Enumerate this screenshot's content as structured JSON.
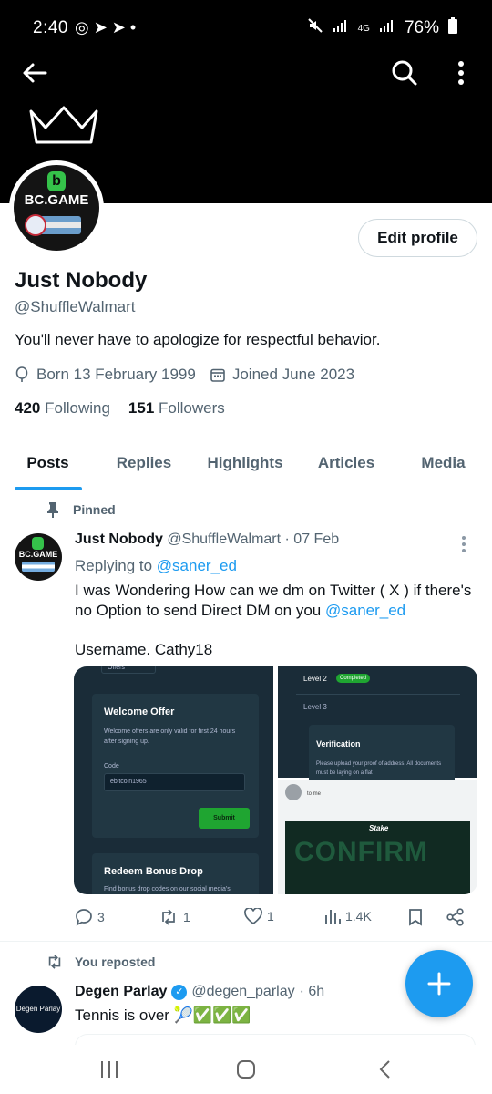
{
  "status_bar": {
    "time": "2:40",
    "left_icons": "◎ ➤ ➤ •",
    "network": "4G",
    "battery": "76%"
  },
  "profile": {
    "avatar_text": "BC.GAME",
    "avatar_logo": "b",
    "edit_button": "Edit profile",
    "name": "Just Nobody",
    "handle": "@ShuffleWalmart",
    "bio": "You'll never have to apologize for respectful behavior.",
    "birth": "Born 13 February 1999",
    "joined": "Joined June 2023",
    "following_count": "420",
    "following_label": "Following",
    "followers_count": "151",
    "followers_label": "Followers"
  },
  "tabs": [
    {
      "label": "Posts",
      "active": true
    },
    {
      "label": "Replies",
      "active": false
    },
    {
      "label": "Highlights",
      "active": false
    },
    {
      "label": "Articles",
      "active": false
    },
    {
      "label": "Media",
      "active": false
    }
  ],
  "pinned_post": {
    "pinned_label": "Pinned",
    "author_name": "Just Nobody",
    "author_handle": "@ShuffleWalmart",
    "date": "· 07 Feb",
    "replying_prefix": "Replying to",
    "replying_to": "@saner_ed",
    "text": "I was Wondering How can we dm on Twitter ( X ) if there's no Option to send Direct DM on you",
    "text_mention": "@saner_ed",
    "text_line2": "Username. Cathy18",
    "media": {
      "img1": {
        "top_label": "Offers",
        "title": "Welcome Offer",
        "desc": "Welcome offers are only valid for first 24 hours after signing up.",
        "code_label": "Code",
        "code_value": "ebitcoin1965",
        "submit": "Submit",
        "title2": "Redeem Bonus Drop",
        "desc2": "Find bonus drop codes on our social media's"
      },
      "img2": {
        "level2": "Level 2",
        "completed": "Completed",
        "level3": "Level 3",
        "verification": "Verification",
        "desc": "Please upload your proof of address. All documents must be laying on a flat"
      },
      "img3": {
        "to_me": "to me",
        "brand": "Stake",
        "confirm": "CONFIRM"
      }
    },
    "replies": "3",
    "reposts": "1",
    "likes": "1",
    "views": "1.4K"
  },
  "repost": {
    "label": "You reposted",
    "author_name": "Degen Parlay",
    "author_handle": "@degen_parlay",
    "time": "· 6h",
    "text": "Tennis is over 🎾✅✅✅",
    "avatar_text": "Degen Parlay"
  },
  "colors": {
    "accent": "#1d9bf0",
    "secondary_text": "#536471",
    "header_bg": "#000000"
  }
}
